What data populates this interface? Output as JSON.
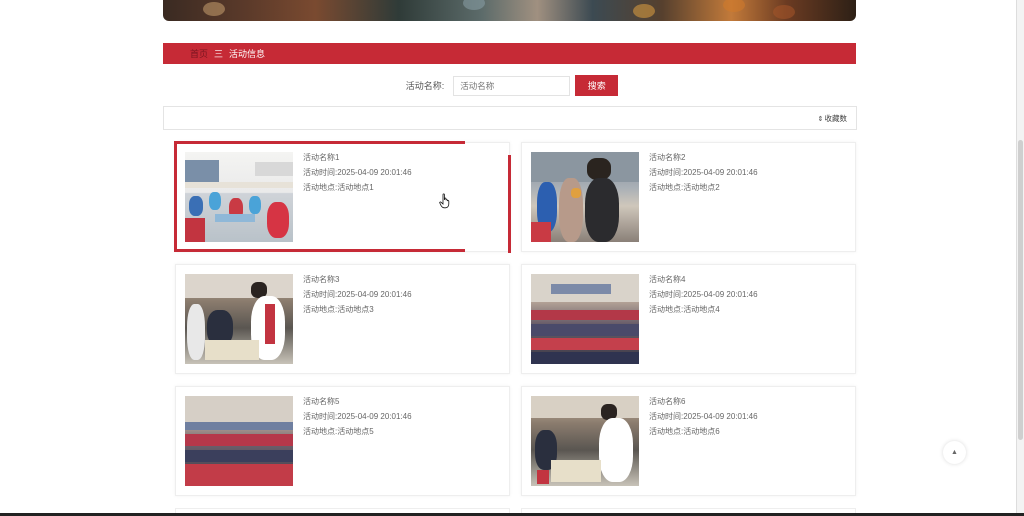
{
  "breadcrumb": {
    "home": "首页",
    "separator": "三",
    "current": "活动信息"
  },
  "search": {
    "label": "活动名称:",
    "placeholder": "活动名称",
    "button": "搜索"
  },
  "sort": {
    "label": "收藏数"
  },
  "activities": [
    {
      "name": "活动名称1",
      "time_label": "活动时间:",
      "time": "2025-04-09 20:01:46",
      "place_label": "活动地点:",
      "place": "活动地点1"
    },
    {
      "name": "活动名称2",
      "time_label": "活动时间:",
      "time": "2025-04-09 20:01:46",
      "place_label": "活动地点:",
      "place": "活动地点2"
    },
    {
      "name": "活动名称3",
      "time_label": "活动时间:",
      "time": "2025-04-09 20:01:46",
      "place_label": "活动地点:",
      "place": "活动地点3"
    },
    {
      "name": "活动名称4",
      "time_label": "活动时间:",
      "time": "2025-04-09 20:01:46",
      "place_label": "活动地点:",
      "place": "活动地点4"
    },
    {
      "name": "活动名称5",
      "time_label": "活动时间:",
      "time": "2025-04-09 20:01:46",
      "place_label": "活动地点:",
      "place": "活动地点5"
    },
    {
      "name": "活动名称6",
      "time_label": "活动时间:",
      "time": "2025-04-09 20:01:46",
      "place_label": "活动地点:",
      "place": "活动地点6"
    }
  ],
  "icons": {
    "sort": "sort-icon",
    "back_to_top": "chevron-up-icon",
    "pointer": "hand-pointer-icon"
  },
  "colors": {
    "accent": "#c62a36",
    "breadcrumb_home": "#7a1520"
  }
}
